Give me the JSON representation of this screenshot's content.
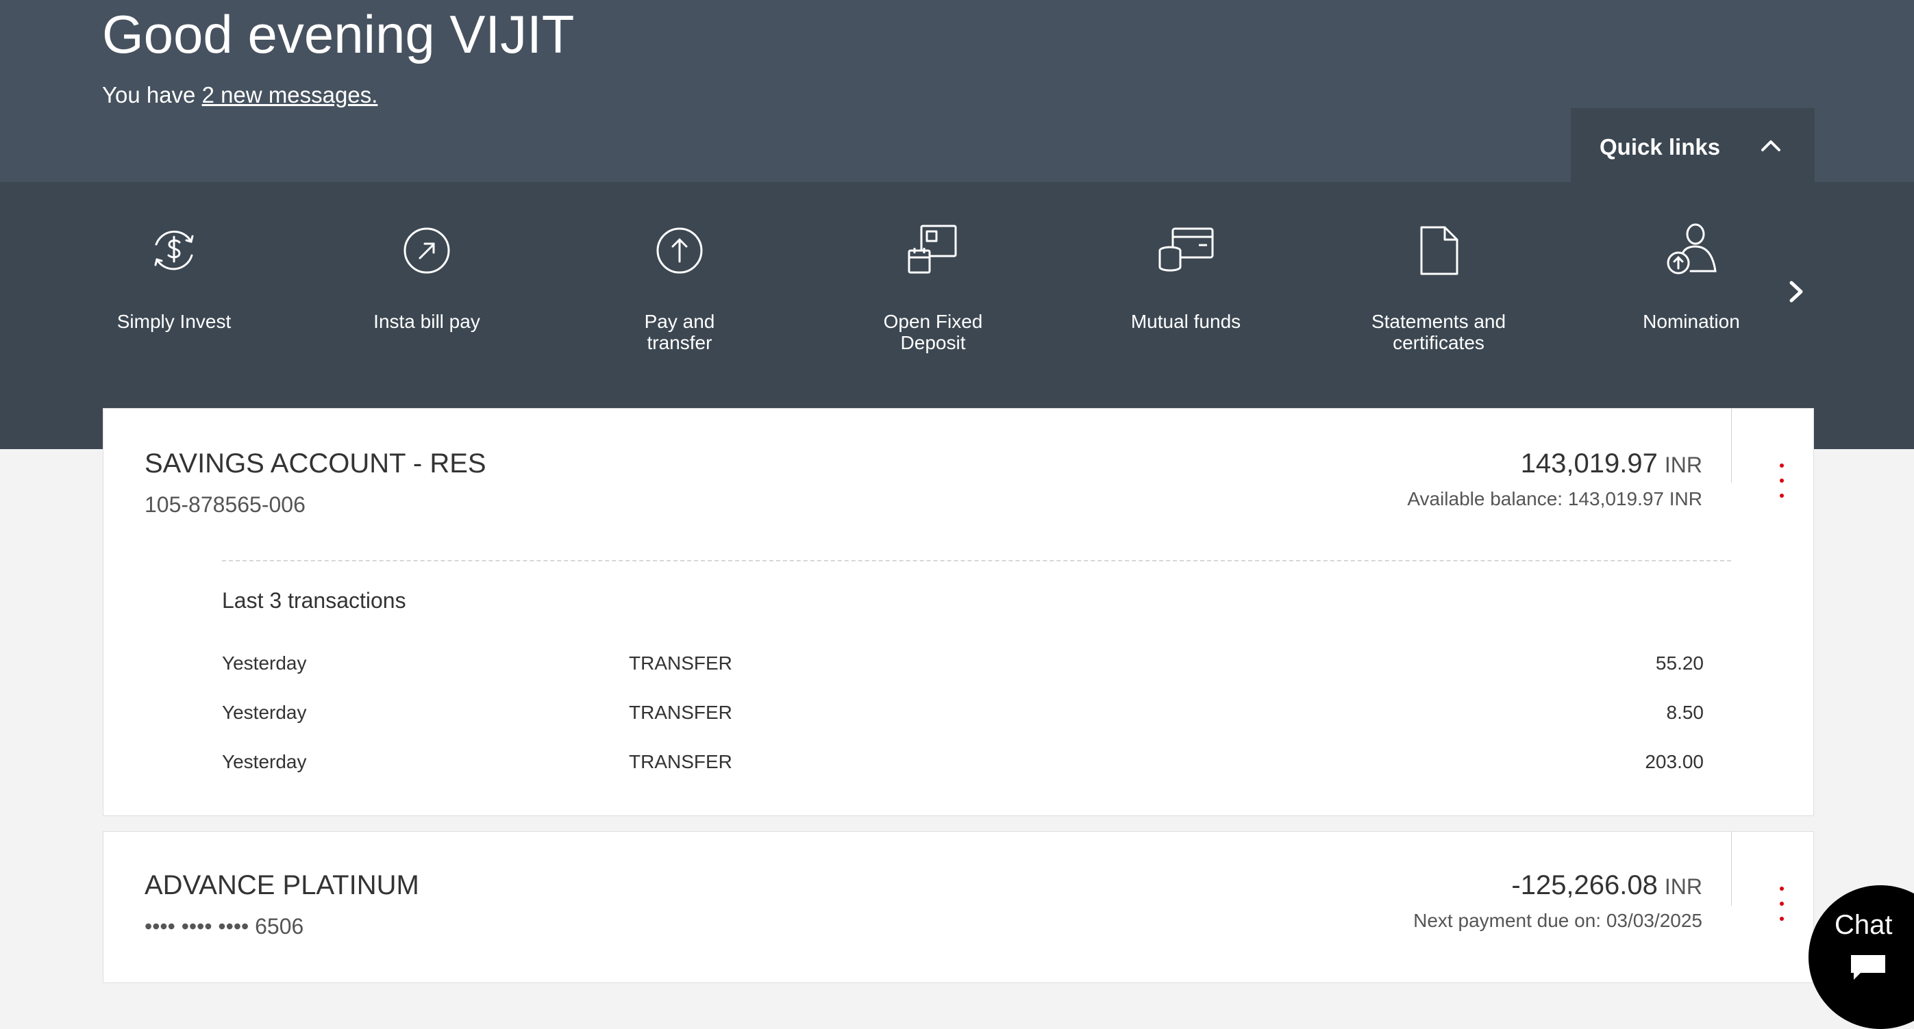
{
  "header": {
    "greeting": "Good evening VIJIT",
    "messages_prefix": "You have ",
    "messages_link": "2 new messages."
  },
  "quick_links": {
    "toggle_label": "Quick links",
    "toggle_icon": "chevron-up-icon",
    "next_icon": "chevron-right-icon",
    "items": [
      {
        "label": "Simply Invest",
        "icon": "dollar-refresh-icon"
      },
      {
        "label": "Insta bill pay",
        "icon": "arrow-up-right-circle-icon"
      },
      {
        "label": "Pay and transfer",
        "icon": "arrow-up-circle-icon"
      },
      {
        "label": "Open Fixed Deposit",
        "icon": "fixed-deposit-icon"
      },
      {
        "label": "Mutual funds",
        "icon": "coins-card-icon"
      },
      {
        "label": "Statements and certificates",
        "icon": "document-icon"
      },
      {
        "label": "Nomination",
        "icon": "person-upload-icon"
      }
    ]
  },
  "accounts": [
    {
      "name": "SAVINGS ACCOUNT - RES",
      "number": "105-878565-006",
      "balance": "143,019.97",
      "currency": "INR",
      "subtext": "Available balance: 143,019.97 INR",
      "transactions_heading": "Last 3 transactions",
      "transactions": [
        {
          "date": "Yesterday",
          "description": "TRANSFER",
          "amount": "55.20"
        },
        {
          "date": "Yesterday",
          "description": "TRANSFER",
          "amount": "8.50"
        },
        {
          "date": "Yesterday",
          "description": "TRANSFER",
          "amount": "203.00"
        }
      ]
    },
    {
      "name": "ADVANCE PLATINUM",
      "number": "•••• •••• •••• 6506",
      "balance": "-125,266.08",
      "currency": "INR",
      "subtext": "Next payment due on: 03/03/2025"
    }
  ],
  "chat": {
    "label": "Chat",
    "icon": "chat-bubble-icon"
  },
  "colors": {
    "header_bg": "#46525f",
    "quick_links_bg": "#3c4751",
    "accent_red": "#db0011",
    "chat_bg": "#000000"
  }
}
